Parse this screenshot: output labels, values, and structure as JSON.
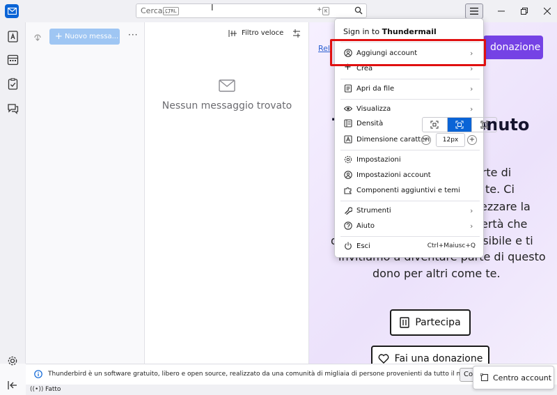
{
  "search": {
    "placeholder": "Cerca...",
    "kbd1": "CTRL",
    "kbd_plus": "+",
    "kbd2": "K"
  },
  "folder_pane": {
    "new_message_label": "Nuovo messa...",
    "more_label": "···"
  },
  "thread_pane": {
    "quick_filter_label": "Filtro veloce",
    "empty_label": "Nessun messaggio trovato"
  },
  "message_pane": {
    "link_text": "Rel",
    "donate_top_label": "donazione",
    "hero_left": "T",
    "hero_right": "enuto",
    "para_right": [
      "arte di",
      "te. Ci",
      "ezzare la",
      "ertà che",
      "ssibile e ti"
    ],
    "para_left": [
      "d"
    ],
    "para_bottom": [
      "invitiamo a diventare parte di questo",
      "dono per altri come te."
    ],
    "join_label": "Partecipa",
    "donate_label": "Fai una donazione"
  },
  "notification": {
    "text": "Thunderbird è un software gratuito, libero e open source, realizzato da una comunità di migliaia di persone provenienti da tutto il mondo.",
    "button_label": "Co"
  },
  "status": {
    "text": "Fatto"
  },
  "account_center": {
    "label": "Centro account"
  },
  "app_menu": {
    "header_prefix": "Sign in to ",
    "header_brand": "Thundermail",
    "items": [
      {
        "label": "Aggiungi account",
        "has_submenu": true
      },
      {
        "label": "Crea",
        "has_submenu": true
      },
      {
        "label": "Apri da file",
        "has_submenu": true
      },
      {
        "label": "Visualizza",
        "has_submenu": true
      },
      {
        "label": "Densità",
        "has_submenu": false
      },
      {
        "label": "Dimensione caratteri",
        "has_submenu": false
      },
      {
        "label": "Impostazioni",
        "has_submenu": false
      },
      {
        "label": "Impostazioni account",
        "has_submenu": false
      },
      {
        "label": "Componenti aggiuntivi e temi",
        "has_submenu": false
      },
      {
        "label": "Strumenti",
        "has_submenu": true
      },
      {
        "label": "Aiuto",
        "has_submenu": true
      },
      {
        "label": "Esci",
        "has_submenu": false,
        "shortcut": "Ctrl+Maiusc+Q"
      }
    ],
    "font_size_value": "12px",
    "font_minus": "−",
    "font_plus": "+"
  },
  "colors": {
    "accent": "#0a64d6",
    "donate": "#7542e5",
    "highlight": "#e01010"
  }
}
